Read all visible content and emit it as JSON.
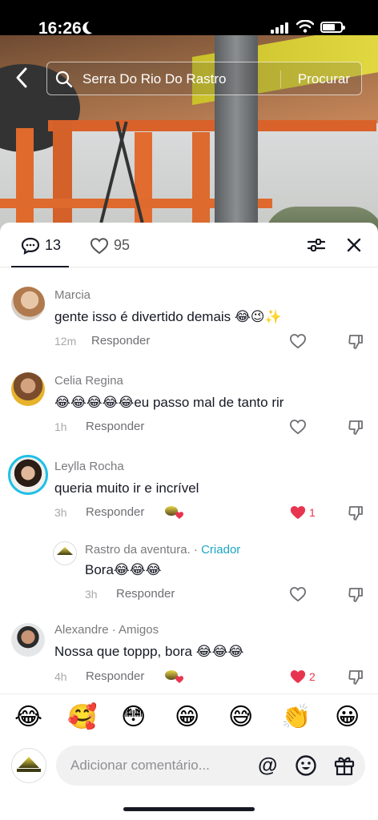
{
  "status_bar": {
    "time": "16:26"
  },
  "search": {
    "query": "Serra Do Rio Do Rastro",
    "submit_label": "Procurar"
  },
  "tabs": {
    "comments_count": "13",
    "likes_count": "95"
  },
  "comments": [
    {
      "name": "Marcia",
      "text": "gente isso é divertido demais 😂😉✨",
      "time": "12m",
      "reply": "Responder"
    },
    {
      "name": "Celia Regina",
      "text": "😂😂😂😂😂eu passo mal de tanto rir",
      "time": "1h",
      "reply": "Responder"
    },
    {
      "name": "Leylla Rocha",
      "text": "queria muito ir e incrível",
      "time": "3h",
      "reply": "Responder",
      "likes": "1"
    },
    {
      "name": "Rastro da aventura.",
      "badge": "Criador",
      "text": "Bora😂😂😂",
      "time": "3h",
      "reply": "Responder"
    },
    {
      "name": "Alexandre · Amigos",
      "text": "Nossa que toppp, bora 😂😂😂",
      "time": "4h",
      "reply": "Responder",
      "likes": "2"
    }
  ],
  "quick_emojis": [
    "😂",
    "🥰",
    "😳",
    "😁",
    "😅",
    "👏",
    "😀"
  ],
  "composer": {
    "placeholder": "Adicionar comentário...",
    "at_symbol": "@"
  },
  "colors": {
    "like_red": "#e8354f",
    "creator_teal": "#1da6c4",
    "story_ring": "#20c0e6"
  },
  "icons": [
    "back-icon",
    "search-icon",
    "comment-icon",
    "heart-icon",
    "filter-icon",
    "close-icon",
    "dislike-icon",
    "emoji-face-icon",
    "gift-icon"
  ]
}
